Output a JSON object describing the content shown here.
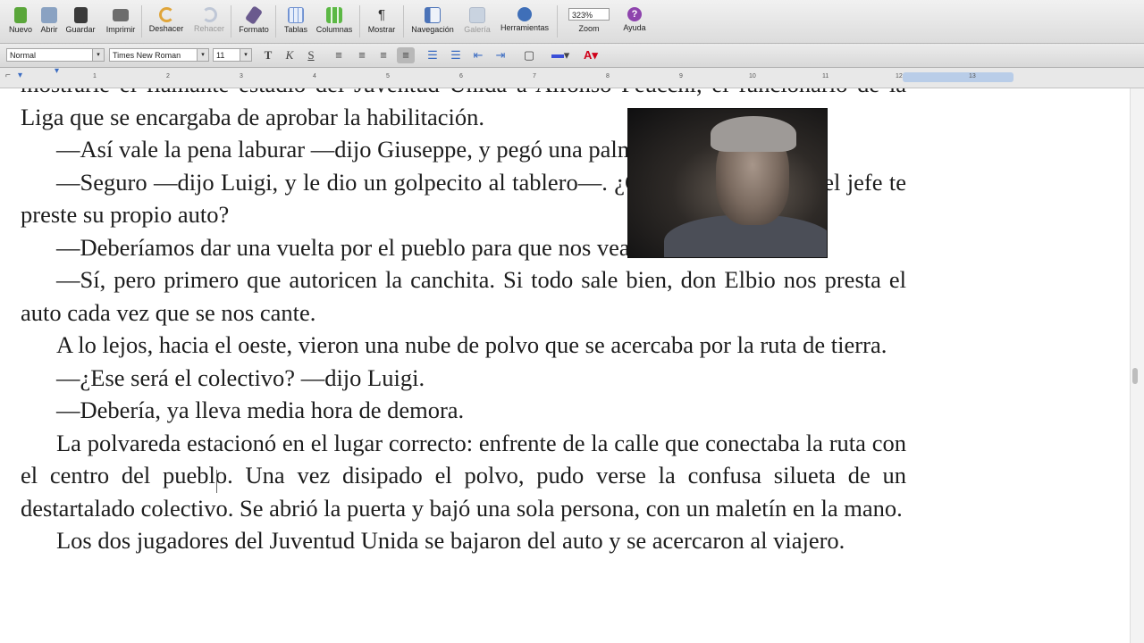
{
  "toolbar": {
    "buttons": [
      {
        "label": "Nuevo"
      },
      {
        "label": "Abrir"
      },
      {
        "label": "Guardar"
      },
      {
        "label": "Imprimir"
      },
      {
        "label": "Deshacer"
      },
      {
        "label": "Rehacer"
      },
      {
        "label": "Formato"
      },
      {
        "label": "Tablas"
      },
      {
        "label": "Columnas"
      },
      {
        "label": "Mostrar"
      },
      {
        "label": "Navegación"
      },
      {
        "label": "Galería"
      },
      {
        "label": "Herramientas"
      },
      {
        "label": "Zoom"
      },
      {
        "label": "Ayuda"
      }
    ],
    "zoom_value": "323%"
  },
  "format_bar": {
    "style": "Normal",
    "font": "Times New Roman",
    "size": "11",
    "buttons": [
      "T",
      "K",
      "S"
    ]
  },
  "ruler": {
    "ticks": [
      "1",
      "2",
      "3",
      "4",
      "5",
      "6",
      "7",
      "8",
      "9",
      "10",
      "11",
      "12",
      "13"
    ]
  },
  "document": {
    "paragraphs": [
      {
        "text": "mostrarle el flamante estadio del Juventud Unida a Alfonso Peucchi, el funcionario de la Liga que se encargaba de aprobar la habilitación.",
        "indent": false
      },
      {
        "text": "—Así vale la pena laburar —dijo Giuseppe, y pegó una palmada al volante.",
        "indent": true
      },
      {
        "text": "—Seguro —dijo Luigi, y le dio un golpecito al tablero—. ¿Cuándo se viste que el jefe te preste su propio auto?",
        "indent": true
      },
      {
        "text": "—Deberíamos dar una vuelta por el pueblo para que nos vean.",
        "indent": true
      },
      {
        "text": "—Sí, pero primero que autoricen la canchita. Si todo sale bien, don Elbio nos presta el auto cada vez que se nos cante.",
        "indent": true
      },
      {
        "text": "A lo lejos, hacia el oeste, vieron una nube de polvo que se acercaba por la ruta de tierra.",
        "indent": true
      },
      {
        "text": "—¿Ese será el colectivo? —dijo Luigi.",
        "indent": true
      },
      {
        "text": "—Debería, ya lleva media hora de demora.",
        "indent": true
      },
      {
        "text": "La polvareda estacionó en el lugar correcto: enfrente de la calle que conectaba la ruta con el centro del pueblo. Una vez disipado el polvo, pudo verse la confusa silueta de un destartalado colectivo. Se abrió la puerta y bajó una sola persona, con un maletín en la mano.",
        "indent": true
      },
      {
        "text": "Los dos jugadores del Juventud Unida se bajaron del auto y se acercaron al viajero.",
        "indent": true
      }
    ]
  },
  "colors": {
    "font_color_bar": "#d0021b",
    "highlight_bar": "#3a4fd8",
    "help_icon": "#8e44ad"
  }
}
